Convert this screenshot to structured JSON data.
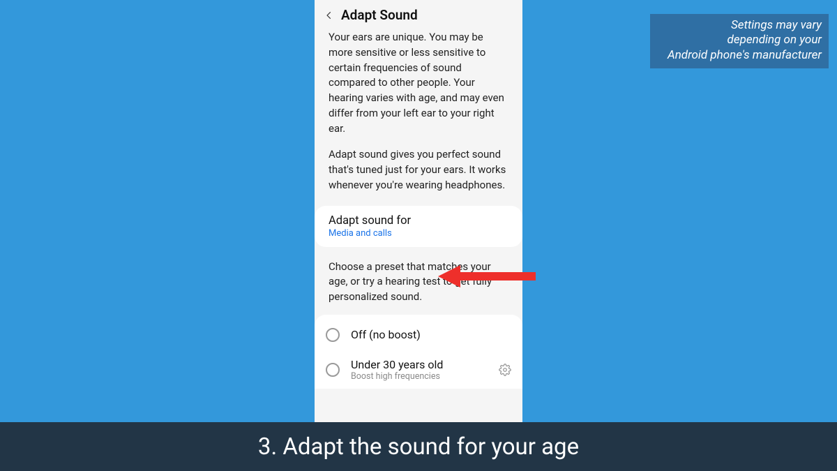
{
  "header": {
    "title": "Adapt Sound"
  },
  "description": {
    "para1": "Your ears are unique. You may be more sensitive or less sensitive to certain frequencies of sound compared to other people. Your hearing varies with age, and may even differ from your left ear to your right ear.",
    "para2": "Adapt sound gives you perfect sound that's tuned just for your ears. It works whenever you're wearing headphones."
  },
  "adapt_for": {
    "title": "Adapt sound for",
    "value": "Media and calls"
  },
  "preset_desc": "Choose a preset that matches your age, or try a hearing test to get fully personalized sound.",
  "presets": {
    "off": {
      "label": "Off (no boost)"
    },
    "under30": {
      "label": "Under 30 years old",
      "sub": "Boost high frequencies"
    }
  },
  "disclaimer": {
    "line1": "Settings may vary",
    "line2": "depending on your",
    "line3": "Android phone's manufacturer"
  },
  "caption": "3. Adapt the sound for your age"
}
